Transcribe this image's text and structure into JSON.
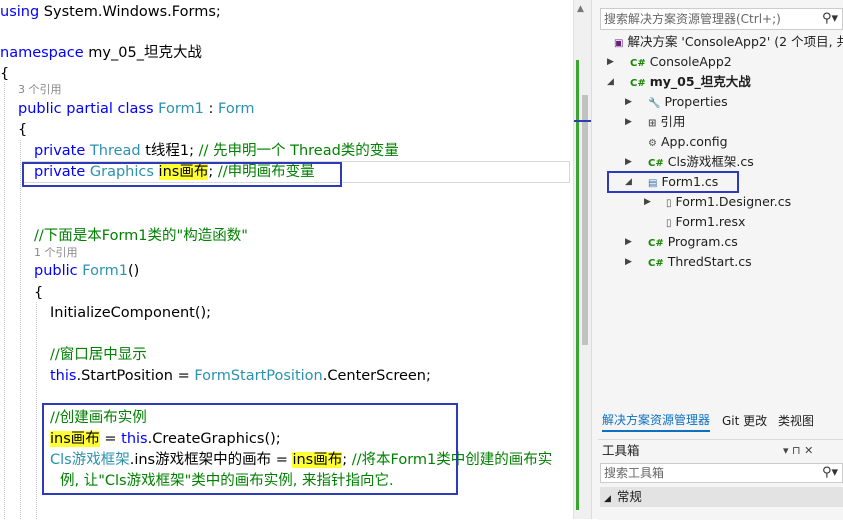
{
  "editor": {
    "using_kw": "using",
    "using_ns": "System.Windows.Forms;",
    "ns_kw": "namespace",
    "ns_name": "my_05_坦克大战",
    "brace_open": "{",
    "ref3": "3 个引用",
    "class_kw": "public partial class",
    "class_name": "Form1",
    "class_colon": " : ",
    "class_base": "Form",
    "brace2": "{",
    "f1_kw": "private",
    "f1_type": "Thread",
    "f1_name": "t线程1;",
    "f1_comment": "// 先申明一个 Thread类的变量",
    "f2_kw": "private",
    "f2_type": "Graphics",
    "f2_name": "ins画布",
    "f2_semi": ";",
    "f2_comment": "//申明画布变量",
    "c_ctor": "//下面是本Form1类的\"构造函数\"",
    "ref1": "1 个引用",
    "ctor_kw": "public",
    "ctor_name": "Form1",
    "ctor_parens": "()",
    "brace3": "{",
    "init": "InitializeComponent();",
    "c_center": "//窗口居中显示",
    "pos_this": "this",
    "pos_mid": ".StartPosition = ",
    "pos_type": "FormStartPosition",
    "pos_end": ".CenterScreen;",
    "c_create": "//创建画布实例",
    "cr_var": "ins画布",
    "cr_eq": " = ",
    "cr_this": "this",
    "cr_call": ".CreateGraphics();",
    "as_type": "Cls游戏框架",
    "as_mid": ".ins游戏框架中的画布 = ",
    "as_var": "ins画布",
    "as_semi": ";",
    "as_comment": " //将本Form1类中创建的画布实",
    "as_cont": "例, 让\"Cls游戏框架\"类中的画布实例, 来指针指向它."
  },
  "solution_explorer": {
    "search_placeholder": "搜索解决方案资源管理器(Ctrl+;)",
    "search_icon": "search-icon",
    "solution": "解决方案 'ConsoleApp2' (2 个项目, 共",
    "project1": "ConsoleApp2",
    "project2": "my_05_坦克大战",
    "properties": "Properties",
    "references": "引用",
    "appconfig": "App.config",
    "cls": "Cls游戏框架.cs",
    "form1": "Form1.cs",
    "designer": "Form1.Designer.cs",
    "resx": "Form1.resx",
    "program": "Program.cs",
    "thred": "ThredStart.cs",
    "cs_icon_text": "C#"
  },
  "tabs": {
    "tab1": "解决方案资源管理器",
    "tab2": "Git 更改",
    "tab3": "类视图"
  },
  "toolbox": {
    "title": "工具箱",
    "search_placeholder": "搜索工具箱",
    "group": "常规",
    "pin_glyph": "▾ ⊓ ✕"
  },
  "colors": {
    "keyword": "#0000ff",
    "type": "#2b91af",
    "comment": "#008000",
    "highlight": "#ffff33",
    "box": "#2e3bb8",
    "changebar": "#3aa532"
  }
}
